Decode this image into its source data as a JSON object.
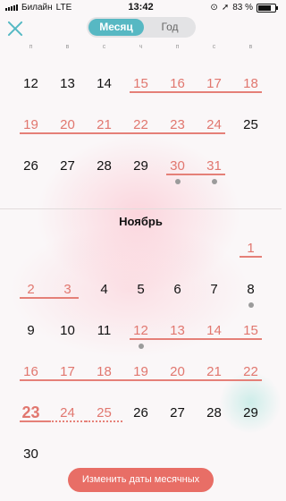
{
  "status": {
    "carrier": "Билайн",
    "network": "LTE",
    "time": "13:42",
    "battery": "83 %",
    "battery_level": 0.83
  },
  "header": {
    "close_icon": "close-icon",
    "segments": [
      {
        "label": "Месяц",
        "active": true
      },
      {
        "label": "Год",
        "active": false
      }
    ]
  },
  "weekdays": [
    "п",
    "в",
    "с",
    "ч",
    "п",
    "с",
    "в"
  ],
  "october": {
    "weeks": [
      [
        {
          "d": "12"
        },
        {
          "d": "13"
        },
        {
          "d": "14"
        },
        {
          "d": "15",
          "s": "p",
          "l": "first"
        },
        {
          "d": "16",
          "s": "p",
          "l": "mid"
        },
        {
          "d": "17",
          "s": "p",
          "l": "mid"
        },
        {
          "d": "18",
          "s": "p",
          "l": "last"
        }
      ],
      [
        {
          "d": "19",
          "s": "p",
          "l": "first"
        },
        {
          "d": "20",
          "s": "p",
          "l": "mid"
        },
        {
          "d": "21",
          "s": "p",
          "l": "mid"
        },
        {
          "d": "22",
          "s": "p",
          "l": "mid"
        },
        {
          "d": "23",
          "s": "p",
          "l": "mid"
        },
        {
          "d": "24",
          "s": "p",
          "l": "last"
        },
        {
          "d": "25"
        }
      ],
      [
        {
          "d": "26"
        },
        {
          "d": "27"
        },
        {
          "d": "28"
        },
        {
          "d": "29"
        },
        {
          "d": "30",
          "s": "p",
          "l": "first",
          "dot": true
        },
        {
          "d": "31",
          "s": "p",
          "l": "last",
          "dot": true
        },
        {
          "d": ""
        }
      ]
    ]
  },
  "november": {
    "title": "Ноябрь",
    "weeks": [
      [
        {
          "d": ""
        },
        {
          "d": ""
        },
        {
          "d": ""
        },
        {
          "d": ""
        },
        {
          "d": ""
        },
        {
          "d": ""
        },
        {
          "d": "1",
          "s": "p",
          "l": "single"
        }
      ],
      [
        {
          "d": "2",
          "s": "p",
          "l": "first"
        },
        {
          "d": "3",
          "s": "p",
          "l": "last"
        },
        {
          "d": "4"
        },
        {
          "d": "5"
        },
        {
          "d": "6"
        },
        {
          "d": "7"
        },
        {
          "d": "8",
          "dot": true
        }
      ],
      [
        {
          "d": "9"
        },
        {
          "d": "10"
        },
        {
          "d": "11"
        },
        {
          "d": "12",
          "s": "p",
          "l": "first",
          "dot": true
        },
        {
          "d": "13",
          "s": "p",
          "l": "mid"
        },
        {
          "d": "14",
          "s": "p",
          "l": "mid"
        },
        {
          "d": "15",
          "s": "p",
          "l": "last"
        }
      ],
      [
        {
          "d": "16",
          "s": "p",
          "l": "first"
        },
        {
          "d": "17",
          "s": "p",
          "l": "mid"
        },
        {
          "d": "18",
          "s": "p",
          "l": "mid"
        },
        {
          "d": "19",
          "s": "p",
          "l": "mid"
        },
        {
          "d": "20",
          "s": "p",
          "l": "mid"
        },
        {
          "d": "21",
          "s": "p",
          "l": "mid"
        },
        {
          "d": "22",
          "s": "p",
          "l": "last"
        }
      ],
      [
        {
          "d": "23",
          "s": "today",
          "l": "first"
        },
        {
          "d": "24",
          "s": "p",
          "l": "dotted"
        },
        {
          "d": "25",
          "s": "p",
          "l": "dotted"
        },
        {
          "d": "26"
        },
        {
          "d": "27"
        },
        {
          "d": "28"
        },
        {
          "d": "29"
        }
      ],
      [
        {
          "d": "30"
        },
        {
          "d": ""
        },
        {
          "d": ""
        },
        {
          "d": ""
        },
        {
          "d": ""
        },
        {
          "d": ""
        },
        {
          "d": ""
        }
      ]
    ]
  },
  "cta": {
    "label": "Изменить даты месячных"
  },
  "colors": {
    "accent": "#57b8c3",
    "period": "#e1776f",
    "cta": "#e86e66"
  }
}
